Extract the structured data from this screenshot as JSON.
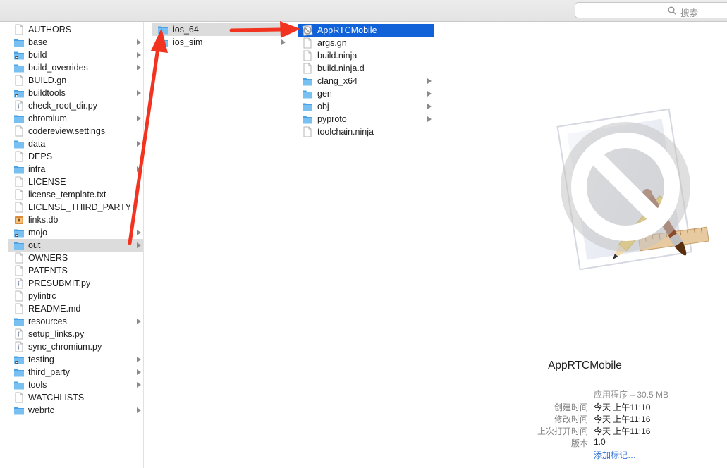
{
  "toolbar": {
    "search_placeholder": "搜索"
  },
  "column1": {
    "items": [
      {
        "label": "AUTHORS",
        "icon": "doc-icon",
        "chevron": false,
        "selected": false
      },
      {
        "label": "base",
        "icon": "folder-icon",
        "chevron": true,
        "selected": false
      },
      {
        "label": "build",
        "icon": "folder-badge-icon",
        "chevron": true,
        "selected": false
      },
      {
        "label": "build_overrides",
        "icon": "folder-icon",
        "chevron": true,
        "selected": false
      },
      {
        "label": "BUILD.gn",
        "icon": "doc-icon",
        "chevron": false,
        "selected": false
      },
      {
        "label": "buildtools",
        "icon": "folder-badge-icon",
        "chevron": true,
        "selected": false
      },
      {
        "label": "check_root_dir.py",
        "icon": "script-icon",
        "chevron": false,
        "selected": false
      },
      {
        "label": "chromium",
        "icon": "folder-icon",
        "chevron": true,
        "selected": false
      },
      {
        "label": "codereview.settings",
        "icon": "doc-icon",
        "chevron": false,
        "selected": false
      },
      {
        "label": "data",
        "icon": "folder-icon",
        "chevron": true,
        "selected": false
      },
      {
        "label": "DEPS",
        "icon": "doc-icon",
        "chevron": false,
        "selected": false
      },
      {
        "label": "infra",
        "icon": "folder-icon",
        "chevron": true,
        "selected": false
      },
      {
        "label": "LICENSE",
        "icon": "doc-icon",
        "chevron": false,
        "selected": false
      },
      {
        "label": "license_template.txt",
        "icon": "doc-icon",
        "chevron": false,
        "selected": false
      },
      {
        "label": "LICENSE_THIRD_PARTY",
        "icon": "doc-icon",
        "chevron": false,
        "selected": false
      },
      {
        "label": "links.db",
        "icon": "database-icon",
        "chevron": false,
        "selected": false
      },
      {
        "label": "mojo",
        "icon": "folder-badge-icon",
        "chevron": true,
        "selected": false
      },
      {
        "label": "out",
        "icon": "folder-icon",
        "chevron": true,
        "selected": true
      },
      {
        "label": "OWNERS",
        "icon": "doc-icon",
        "chevron": false,
        "selected": false
      },
      {
        "label": "PATENTS",
        "icon": "doc-icon",
        "chevron": false,
        "selected": false
      },
      {
        "label": "PRESUBMIT.py",
        "icon": "script-icon",
        "chevron": false,
        "selected": false
      },
      {
        "label": "pylintrc",
        "icon": "doc-icon",
        "chevron": false,
        "selected": false
      },
      {
        "label": "README.md",
        "icon": "doc-icon",
        "chevron": false,
        "selected": false
      },
      {
        "label": "resources",
        "icon": "folder-icon",
        "chevron": true,
        "selected": false
      },
      {
        "label": "setup_links.py",
        "icon": "script-icon",
        "chevron": false,
        "selected": false
      },
      {
        "label": "sync_chromium.py",
        "icon": "script-icon",
        "chevron": false,
        "selected": false
      },
      {
        "label": "testing",
        "icon": "folder-badge-icon",
        "chevron": true,
        "selected": false
      },
      {
        "label": "third_party",
        "icon": "folder-icon",
        "chevron": true,
        "selected": false
      },
      {
        "label": "tools",
        "icon": "folder-icon",
        "chevron": true,
        "selected": false
      },
      {
        "label": "WATCHLISTS",
        "icon": "doc-icon",
        "chevron": false,
        "selected": false
      },
      {
        "label": "webrtc",
        "icon": "folder-icon",
        "chevron": true,
        "selected": false
      }
    ]
  },
  "column2": {
    "items": [
      {
        "label": "ios_64",
        "icon": "folder-icon",
        "chevron": true,
        "selected": true
      },
      {
        "label": "ios_sim",
        "icon": "folder-icon",
        "chevron": true,
        "selected": false
      }
    ]
  },
  "column3": {
    "items": [
      {
        "label": "AppRTCMobile",
        "icon": "app-icon",
        "chevron": false,
        "selected": true
      },
      {
        "label": "args.gn",
        "icon": "doc-icon",
        "chevron": false,
        "selected": false
      },
      {
        "label": "build.ninja",
        "icon": "doc-icon",
        "chevron": false,
        "selected": false
      },
      {
        "label": "build.ninja.d",
        "icon": "doc-icon",
        "chevron": false,
        "selected": false
      },
      {
        "label": "clang_x64",
        "icon": "folder-icon",
        "chevron": true,
        "selected": false
      },
      {
        "label": "gen",
        "icon": "folder-icon",
        "chevron": true,
        "selected": false
      },
      {
        "label": "obj",
        "icon": "folder-icon",
        "chevron": true,
        "selected": false
      },
      {
        "label": "pyproto",
        "icon": "folder-icon",
        "chevron": true,
        "selected": false
      },
      {
        "label": "toolchain.ninja",
        "icon": "doc-icon",
        "chevron": false,
        "selected": false
      }
    ]
  },
  "preview": {
    "name": "AppRTCMobile",
    "kind": "应用程序 – 30.5 MB",
    "details": [
      {
        "label": "创建时间",
        "value": "今天 上午11:10"
      },
      {
        "label": "修改时间",
        "value": "今天 上午11:16"
      },
      {
        "label": "上次打开时间",
        "value": "今天 上午11:16"
      },
      {
        "label": "版本",
        "value": "1.0"
      }
    ],
    "add_tags": "添加标记…"
  },
  "colors": {
    "selection_blue": "#1162d8",
    "selection_grey": "#dcdcdc",
    "folder_blue": "#6cb7ee",
    "annotation_red": "#f2331f",
    "link_blue": "#2f73d8"
  }
}
